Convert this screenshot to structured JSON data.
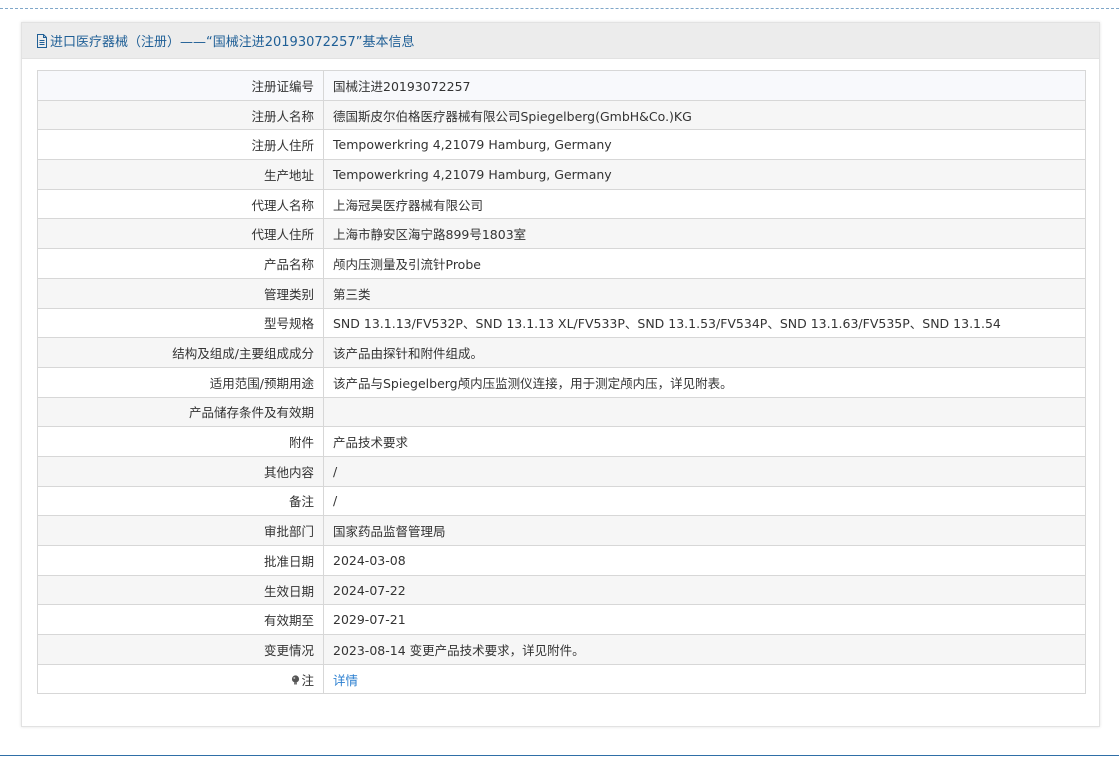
{
  "panel": {
    "title": "进口医疗器械（注册）——“国械注进20193072257”基本信息"
  },
  "rows": [
    {
      "label": "注册证编号",
      "value": "国械注进20193072257"
    },
    {
      "label": "注册人名称",
      "value": "德国斯皮尔伯格医疗器械有限公司Spiegelberg(GmbH&Co.)KG"
    },
    {
      "label": "注册人住所",
      "value": "Tempowerkring 4,21079 Hamburg, Germany"
    },
    {
      "label": "生产地址",
      "value": "Tempowerkring 4,21079 Hamburg, Germany"
    },
    {
      "label": "代理人名称",
      "value": "上海冠昊医疗器械有限公司"
    },
    {
      "label": "代理人住所",
      "value": "上海市静安区海宁路899号1803室"
    },
    {
      "label": "产品名称",
      "value": "颅内压测量及引流针Probe"
    },
    {
      "label": "管理类别",
      "value": "第三类"
    },
    {
      "label": "型号规格",
      "value": "SND 13.1.13/FV532P、SND 13.1.13 XL/FV533P、SND 13.1.53/FV534P、SND 13.1.63/FV535P、SND 13.1.54"
    },
    {
      "label": "结构及组成/主要组成成分",
      "value": "该产品由探针和附件组成。"
    },
    {
      "label": "适用范围/预期用途",
      "value": "该产品与Spiegelberg颅内压监测仪连接，用于测定颅内压，详见附表。"
    },
    {
      "label": "产品储存条件及有效期",
      "value": ""
    },
    {
      "label": "附件",
      "value": "产品技术要求"
    },
    {
      "label": "其他内容",
      "value": "/"
    },
    {
      "label": "备注",
      "value": "/"
    },
    {
      "label": "审批部门",
      "value": "国家药品监督管理局"
    },
    {
      "label": "批准日期",
      "value": "2024-03-08"
    },
    {
      "label": "生效日期",
      "value": "2024-07-22"
    },
    {
      "label": "有效期至",
      "value": "2029-07-21"
    },
    {
      "label": "变更情况",
      "value": "2023-08-14 变更产品技术要求，详见附件。"
    }
  ],
  "note_row": {
    "label": "注",
    "icon": "bulb-icon",
    "link_text": "详情"
  },
  "colors": {
    "title": "#1f5f96",
    "link": "#2b7fd0",
    "header_bg": "#ececec",
    "border": "#d7d7d7"
  }
}
